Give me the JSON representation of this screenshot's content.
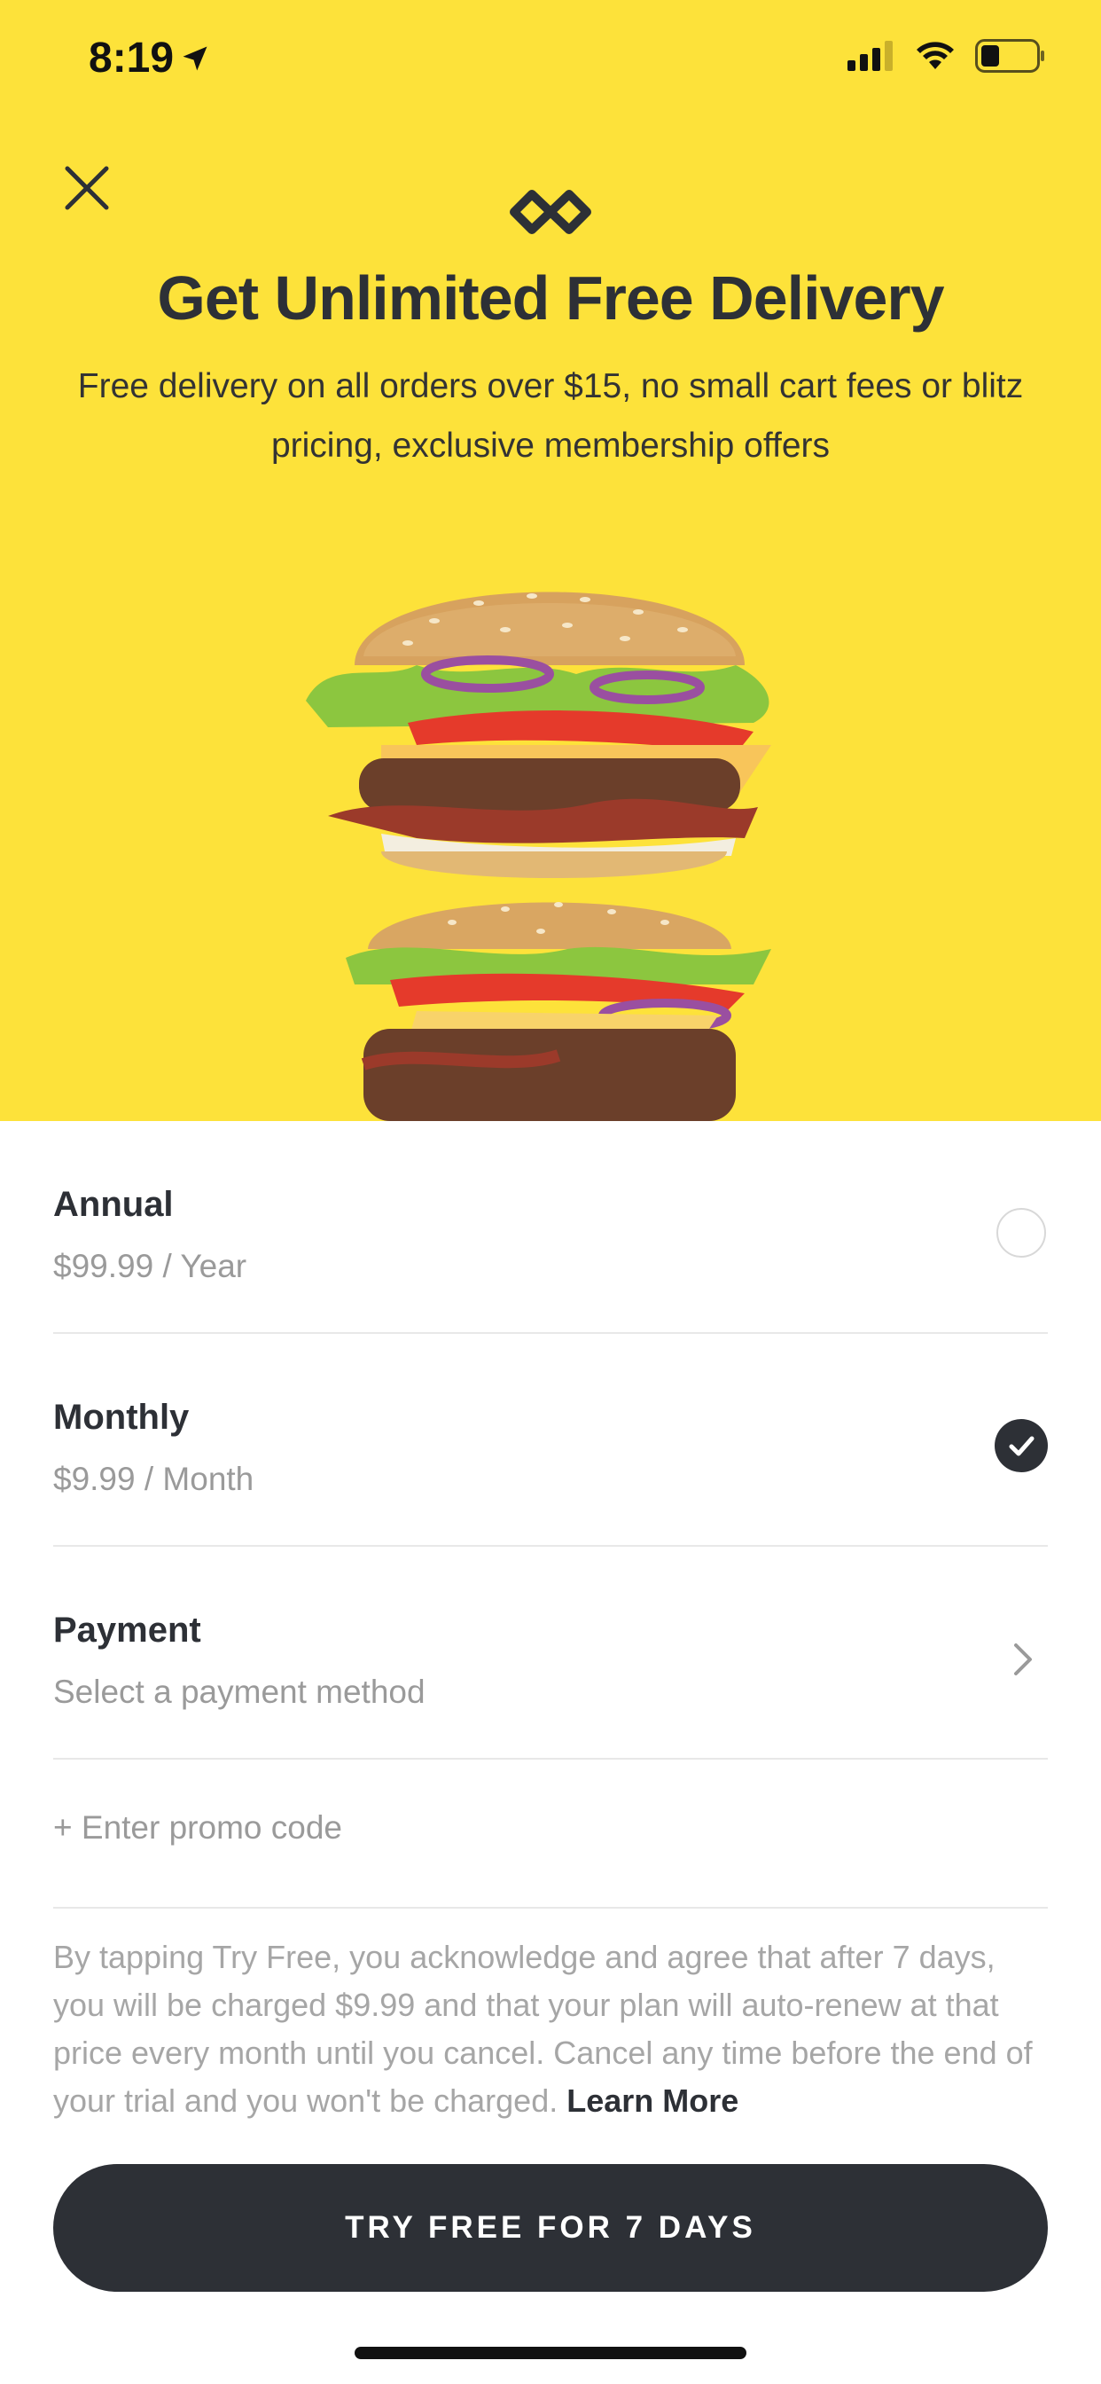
{
  "status_bar": {
    "time": "8:19",
    "icons": [
      "location-arrow-icon",
      "cellular-signal-icon",
      "wifi-icon",
      "battery-icon"
    ]
  },
  "header": {
    "close_icon": "close-icon",
    "logo_icon": "dashpass-logo-icon",
    "title": "Get Unlimited Free Delivery",
    "subtitle": "Free delivery on all orders over $15, no small cart fees or blitz pricing, exclusive membership offers"
  },
  "hero_image": "stacked double burger on yellow background",
  "plans": [
    {
      "title": "Annual",
      "price": "$99.99 / Year",
      "selected": false
    },
    {
      "title": "Monthly",
      "price": "$9.99 / Month",
      "selected": true
    }
  ],
  "payment": {
    "title": "Payment",
    "subtitle": "Select a payment method"
  },
  "promo": {
    "label": "+ Enter promo code"
  },
  "legal": {
    "text": "By tapping Try Free, you acknowledge and agree that after 7 days, you will be charged $9.99 and that your plan will auto-renew at that price every month until you cancel. Cancel any time before the end of your trial and you won't be charged. ",
    "link": "Learn More"
  },
  "cta": {
    "label": "TRY FREE FOR 7 DAYS"
  },
  "colors": {
    "hero_background": "#fde23a",
    "primary_dark": "#2d3036",
    "muted_text": "#9a9a9a"
  }
}
